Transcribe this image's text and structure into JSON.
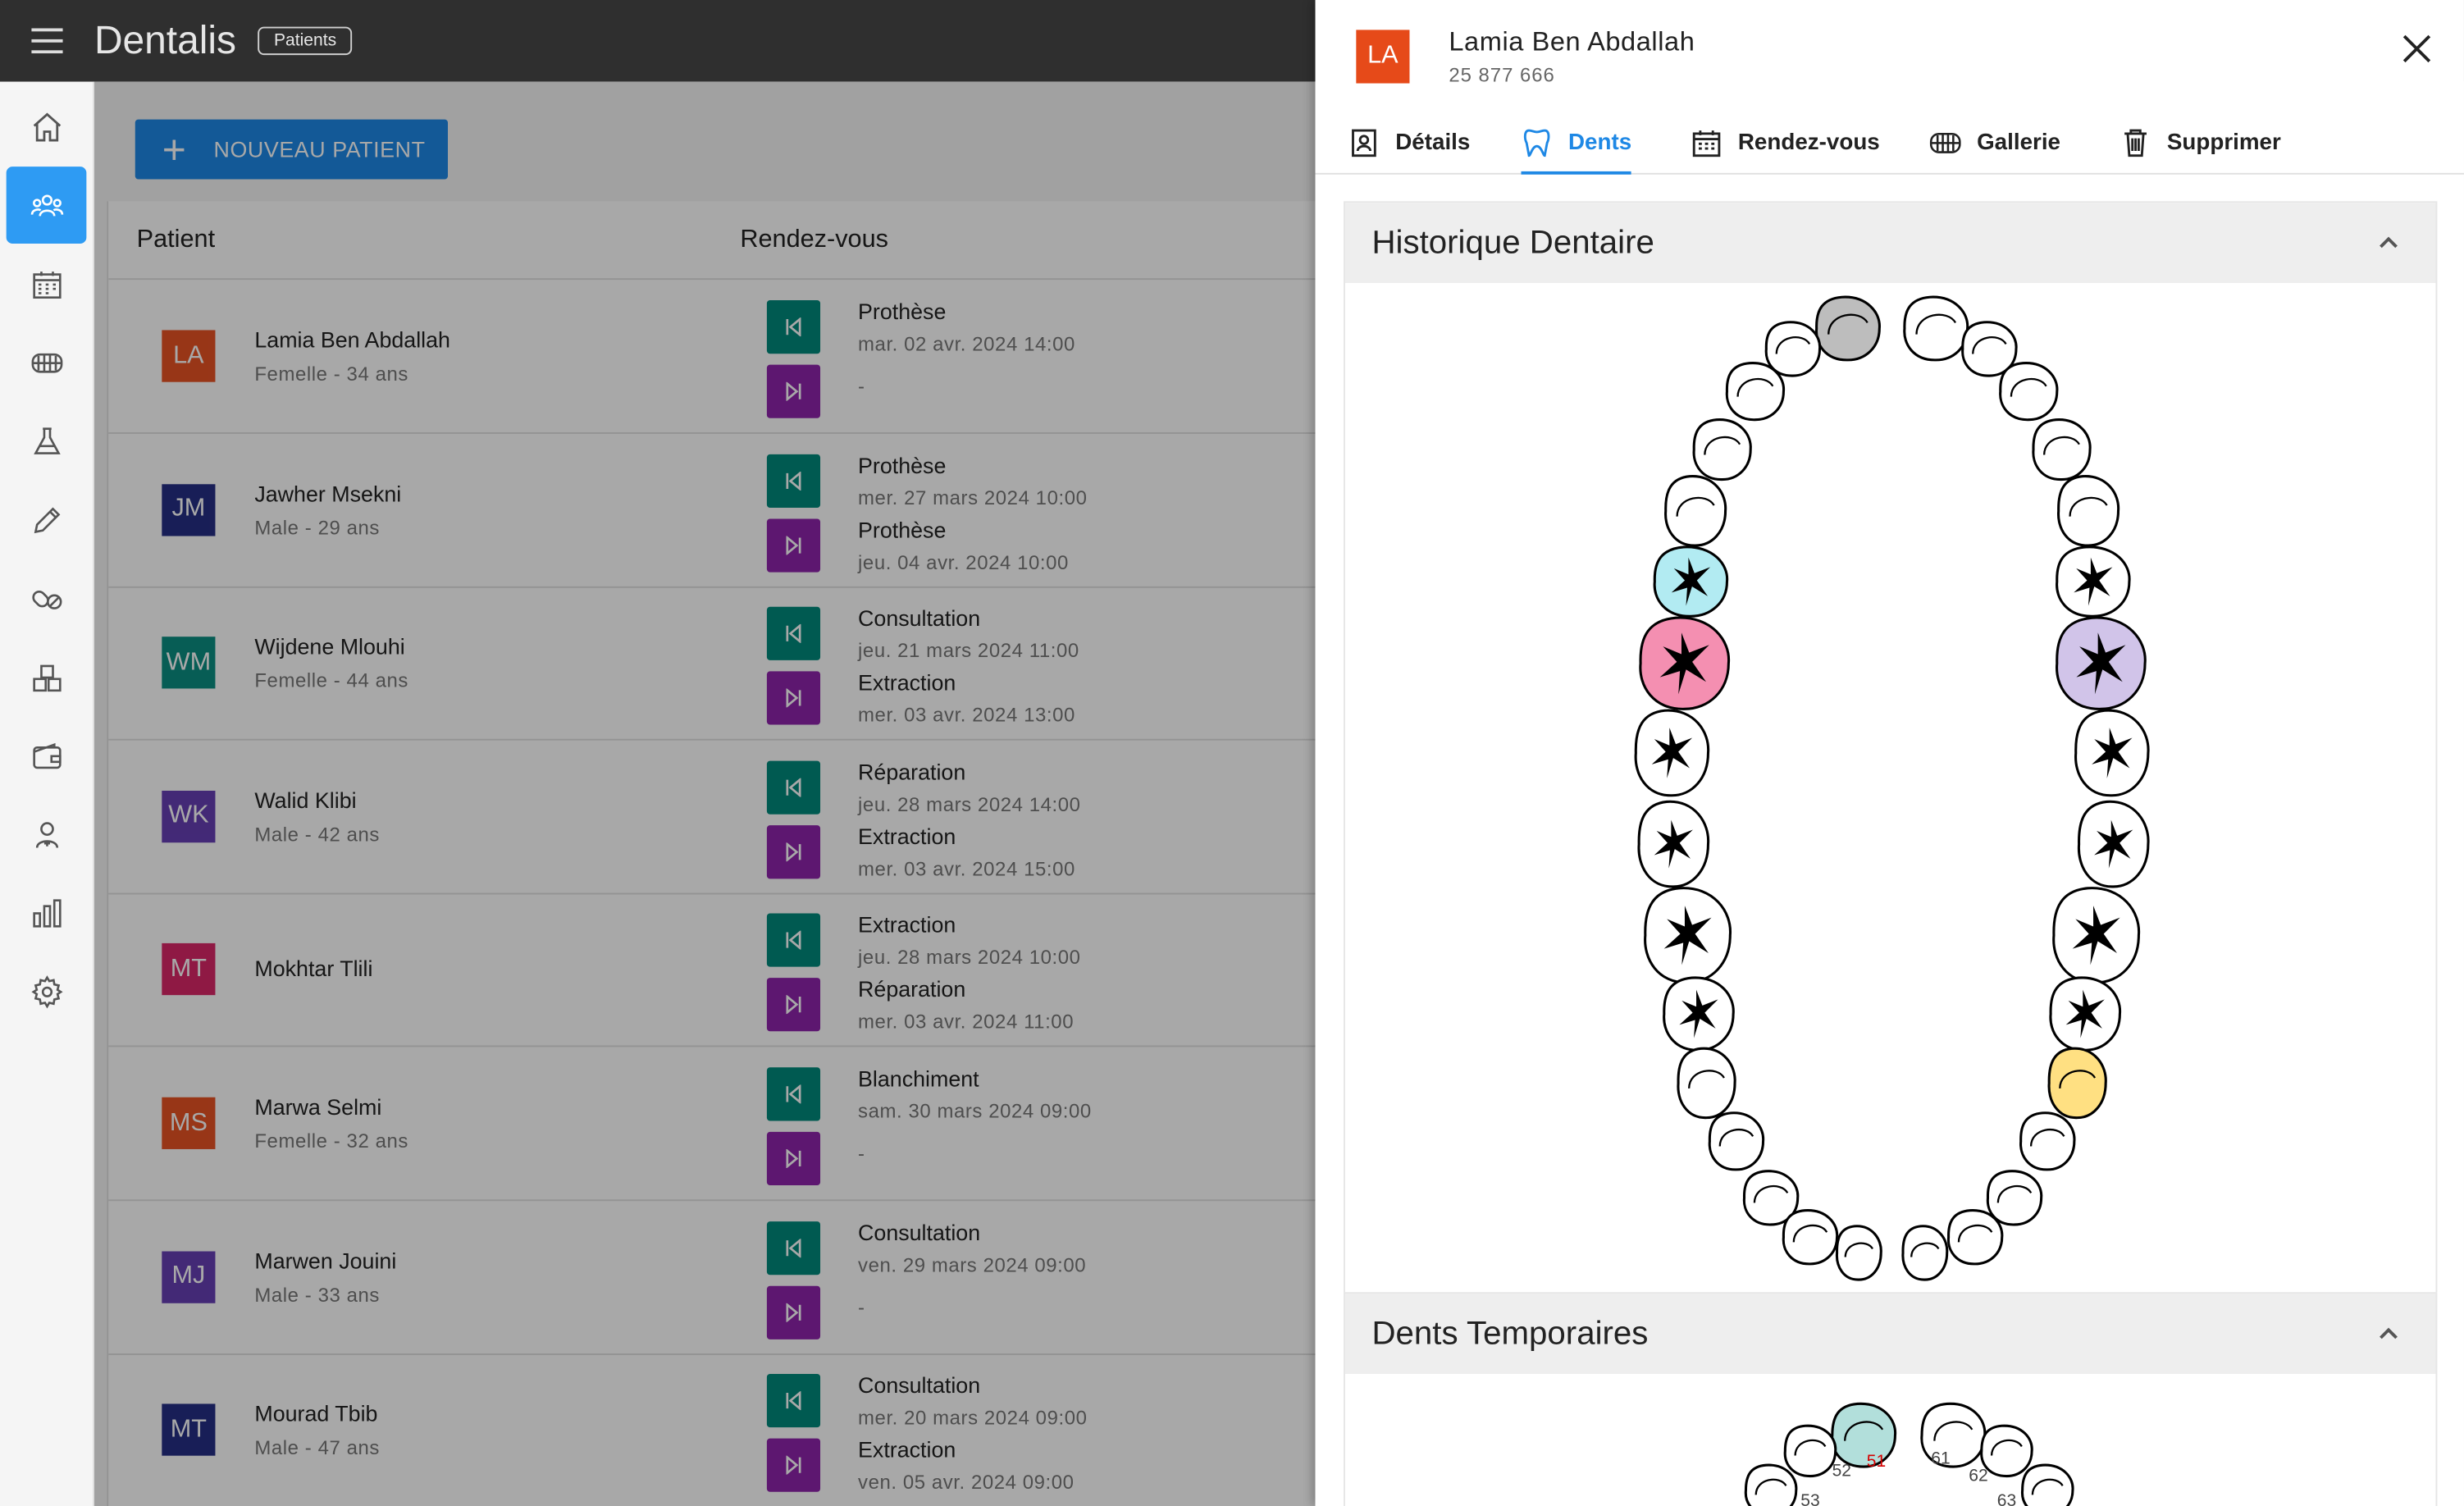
{
  "app": {
    "title": "Dentalis",
    "breadcrumb": "Patients"
  },
  "sidebar": {
    "items": [
      {
        "icon": "home-icon",
        "active": false
      },
      {
        "icon": "patients-icon",
        "active": true
      },
      {
        "icon": "calendar-icon",
        "active": false
      },
      {
        "icon": "dental-arch-icon",
        "active": false
      },
      {
        "icon": "flask-icon",
        "active": false
      },
      {
        "icon": "pen-icon",
        "active": false
      },
      {
        "icon": "pills-icon",
        "active": false
      },
      {
        "icon": "boxes-icon",
        "active": false
      },
      {
        "icon": "wallet-icon",
        "active": false
      },
      {
        "icon": "staff-icon",
        "active": false
      },
      {
        "icon": "stats-icon",
        "active": false
      },
      {
        "icon": "settings-icon",
        "active": false
      }
    ]
  },
  "main": {
    "new_patient_label": "NOUVEAU PATIENT",
    "columns": {
      "patient": "Patient",
      "appointments": "Rendez-vous"
    },
    "rows": [
      {
        "initials": "LA",
        "color": "#e64a19",
        "name": "Lamia Ben Abdallah",
        "info": "Femelle - 34 ans",
        "prev_type": "Prothèse",
        "prev_date": "mar. 02 avr. 2024 14:00",
        "next_type": "",
        "next_date": "-"
      },
      {
        "initials": "JM",
        "color": "#1a237e",
        "name": "Jawher Msekni",
        "info": "Male - 29 ans",
        "prev_type": "Prothèse",
        "prev_date": "mer. 27 mars 2024 10:00",
        "next_type": "Prothèse",
        "next_date": "jeu. 04 avr. 2024 10:00"
      },
      {
        "initials": "WM",
        "color": "#00897b",
        "name": "Wijdene Mlouhi",
        "info": "Femelle - 44 ans",
        "prev_type": "Consultation",
        "prev_date": "jeu. 21 mars 2024 11:00",
        "next_type": "Extraction",
        "next_date": "mer. 03 avr. 2024 13:00"
      },
      {
        "initials": "WK",
        "color": "#5e35b1",
        "name": "Walid Klibi",
        "info": "Male - 42 ans",
        "prev_type": "Réparation",
        "prev_date": "jeu. 28 mars 2024 14:00",
        "next_type": "Extraction",
        "next_date": "mer. 03 avr. 2024 15:00"
      },
      {
        "initials": "MT",
        "color": "#d81b60",
        "name": "Mokhtar Tlili",
        "info": "",
        "prev_type": "Extraction",
        "prev_date": "jeu. 28 mars 2024 10:00",
        "next_type": "Réparation",
        "next_date": "mer. 03 avr. 2024 11:00"
      },
      {
        "initials": "MS",
        "color": "#e64a19",
        "name": "Marwa Selmi",
        "info": "Femelle - 32 ans",
        "prev_type": "Blanchiment",
        "prev_date": "sam. 30 mars 2024 09:00",
        "next_type": "",
        "next_date": "-"
      },
      {
        "initials": "MJ",
        "color": "#5e35b1",
        "name": "Marwen Jouini",
        "info": "Male - 33 ans",
        "prev_type": "Consultation",
        "prev_date": "ven. 29 mars 2024 09:00",
        "next_type": "",
        "next_date": "-"
      },
      {
        "initials": "MT",
        "color": "#1a237e",
        "name": "Mourad Tbib",
        "info": "Male - 47 ans",
        "prev_type": "Consultation",
        "prev_date": "mer. 20 mars 2024 09:00",
        "next_type": "Extraction",
        "next_date": "ven. 05 avr. 2024 09:00"
      }
    ]
  },
  "drawer": {
    "initials": "LA",
    "name": "Lamia Ben Abdallah",
    "phone": "25 877 666",
    "tabs": [
      {
        "label": "Détails",
        "icon": "contact-card-icon",
        "active": false
      },
      {
        "label": "Dents",
        "icon": "tooth-icon",
        "active": true
      },
      {
        "label": "Rendez-vous",
        "icon": "calendar-icon",
        "active": false
      },
      {
        "label": "Gallerie",
        "icon": "dental-arch-icon",
        "active": false
      },
      {
        "label": "Supprimer",
        "icon": "trash-icon",
        "active": false
      }
    ],
    "history_title": "Historique Dentaire",
    "temporary_title": "Dents Temporaires",
    "tooth_colors": {
      "grey": "#bdbdbd",
      "cyan": "#b2ebf2",
      "pink": "#f48fb1",
      "lavender": "#d1c4e9",
      "yellow": "#ffe082",
      "teal": "#b2dfdb"
    },
    "temporary_labels": [
      "52",
      "51",
      "61",
      "62",
      "53",
      "63"
    ]
  }
}
